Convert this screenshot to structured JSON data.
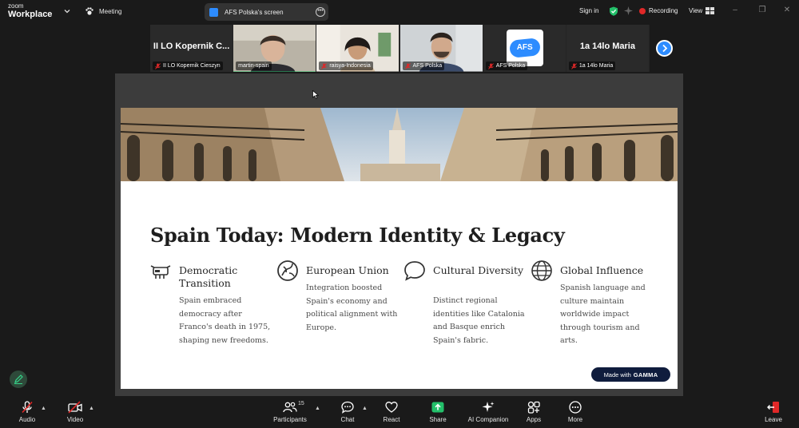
{
  "app": {
    "logo_line1": "zoom",
    "logo_line2": "Workplace",
    "meeting_label": "Meeting",
    "screen_share_label": "AFS Polska's screen",
    "sign_in_label": "Sign in",
    "recording_label": "Recording",
    "view_label": "View"
  },
  "participants": [
    {
      "tile_text": "II LO Kopernik C...",
      "name": "II LO Kopernik Cieszyn",
      "muted": true,
      "video": false
    },
    {
      "tile_text": "",
      "name": "martin-spain",
      "muted": false,
      "video": true,
      "active_speaker": true
    },
    {
      "tile_text": "",
      "name": "raisya-Indonesia",
      "muted": true,
      "video": true
    },
    {
      "tile_text": "",
      "name": "AFS Polska",
      "muted": true,
      "video": true
    },
    {
      "tile_text": "",
      "name": "AFS Polska",
      "muted": true,
      "video": false,
      "logo_text": "AFS"
    },
    {
      "tile_text": "1a 14lo Maria",
      "name": "1a 14lo Maria",
      "muted": true,
      "video": false
    }
  ],
  "slide": {
    "title": "Spain Today: Modern Identity & Legacy",
    "columns": [
      {
        "icon": "bull-icon",
        "heading": "Democratic Transition",
        "body": "Spain embraced democracy after Franco's death in 1975, shaping new freedoms."
      },
      {
        "icon": "europe-icon",
        "heading": "European Union",
        "body": "Integration boosted Spain's economy and political alignment with Europe."
      },
      {
        "icon": "speech-bubble-icon",
        "heading": "Cultural Diversity",
        "body": "Distinct regional identities like Catalonia and Basque enrich Spain's fabric."
      },
      {
        "icon": "globe-icon",
        "heading": "Global Influence",
        "body": "Spanish language and culture maintain worldwide impact through tourism and arts."
      }
    ],
    "badge_prefix": "Made with",
    "badge_brand": "GAMMA"
  },
  "toolbar": {
    "audio_label": "Audio",
    "video_label": "Video",
    "participants_label": "Participants",
    "participants_count": "15",
    "chat_label": "Chat",
    "react_label": "React",
    "share_label": "Share",
    "ai_label": "AI Companion",
    "apps_label": "Apps",
    "more_label": "More",
    "leave_label": "Leave"
  },
  "colors": {
    "accent_blue": "#2d8cff",
    "share_green": "#23c06a",
    "record_red": "#e02828",
    "gamma_navy": "#0f1c3d"
  }
}
